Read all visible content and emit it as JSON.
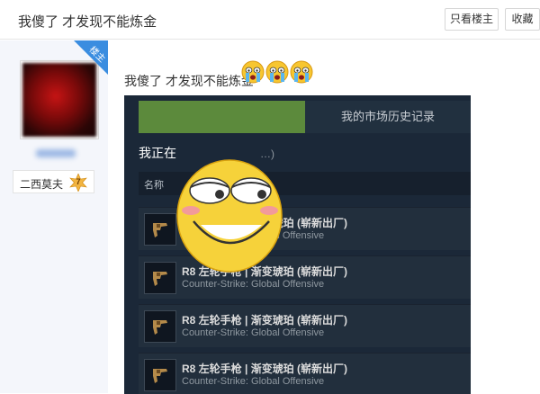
{
  "header": {
    "title": "我傻了 才发现不能炼金",
    "only_op_label": "只看楼主",
    "favorite_label": "收藏"
  },
  "author": {
    "op_badge": "楼主",
    "level_name": "二西莫夫",
    "level_number": "7"
  },
  "post": {
    "text": "我傻了 才发现不能炼金",
    "emoji_count": 3,
    "market": {
      "tab_history": "我的市场历史记录",
      "listing_heading": "我正在",
      "listing_heading_rest": "售的物品 (4)",
      "column_name": "名称",
      "items": [
        {
          "name": "R8 左轮手枪 | 渐变琥珀 (崭新出厂)",
          "game": "Counter-Strike: Global Offensive"
        },
        {
          "name": "R8 左轮手枪 | 渐变琥珀 (崭新出厂)",
          "game": "Counter-Strike: Global Offensive"
        },
        {
          "name": "R8 左轮手枪 | 渐变琥珀 (崭新出厂)",
          "game": "Counter-Strike: Global Offensive"
        },
        {
          "name": "R8 左轮手枪 | 渐变琥珀 (崭新出厂)",
          "game": "Counter-Strike: Global Offensive"
        }
      ]
    }
  },
  "colors": {
    "accent_blue": "#3a8de0",
    "steam_bg": "#1b2838",
    "steam_green": "#5c8a3c",
    "sidebar_bg": "#f4f6fb"
  }
}
